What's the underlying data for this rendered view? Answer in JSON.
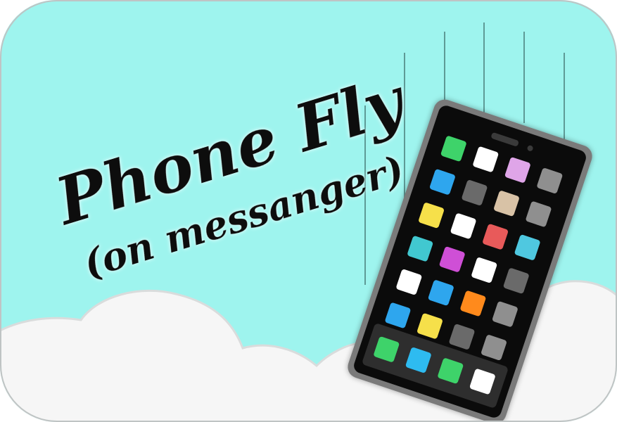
{
  "title": "Phone Fly",
  "subtitle": "(on messanger)",
  "colors": {
    "sky": "#9ef4ee",
    "cloud": "#f6f6f6",
    "cloud_shadow": "#d9dcdc",
    "speed_line": "#5e9a96",
    "phone_frame": "#7a7a7a",
    "phone_screen": "#0b0b0b",
    "dock": "#2e2e2e",
    "text": "#0d0d0d"
  },
  "phone": {
    "icon_rows": [
      [
        "#3ed36a",
        "#ffffff",
        "#dfa5e8",
        "#8f8f8f"
      ],
      [
        "#2ea6ee",
        "#6a6a6a",
        "#d8c2a6",
        "#8f8f8f"
      ],
      [
        "#f6e04a",
        "#ffffff",
        "#e85a5a",
        "#4fc8e0"
      ],
      [
        "#41c8d0",
        "#cf4fd6",
        "#ffffff",
        "#6a6a6a"
      ],
      [
        "#ffffff",
        "#2ea6ee",
        "#ff8a1c",
        "#8f8f8f"
      ],
      [
        "#2ea6ee",
        "#f6e04a",
        "#6a6a6a",
        "#8f8f8f"
      ],
      [
        "#e85a5a",
        "#ffffff",
        "",
        ""
      ]
    ],
    "dock_icons": [
      "#3ed36a",
      "#2ebbf0",
      "#3ed36a",
      "#ffffff"
    ]
  }
}
